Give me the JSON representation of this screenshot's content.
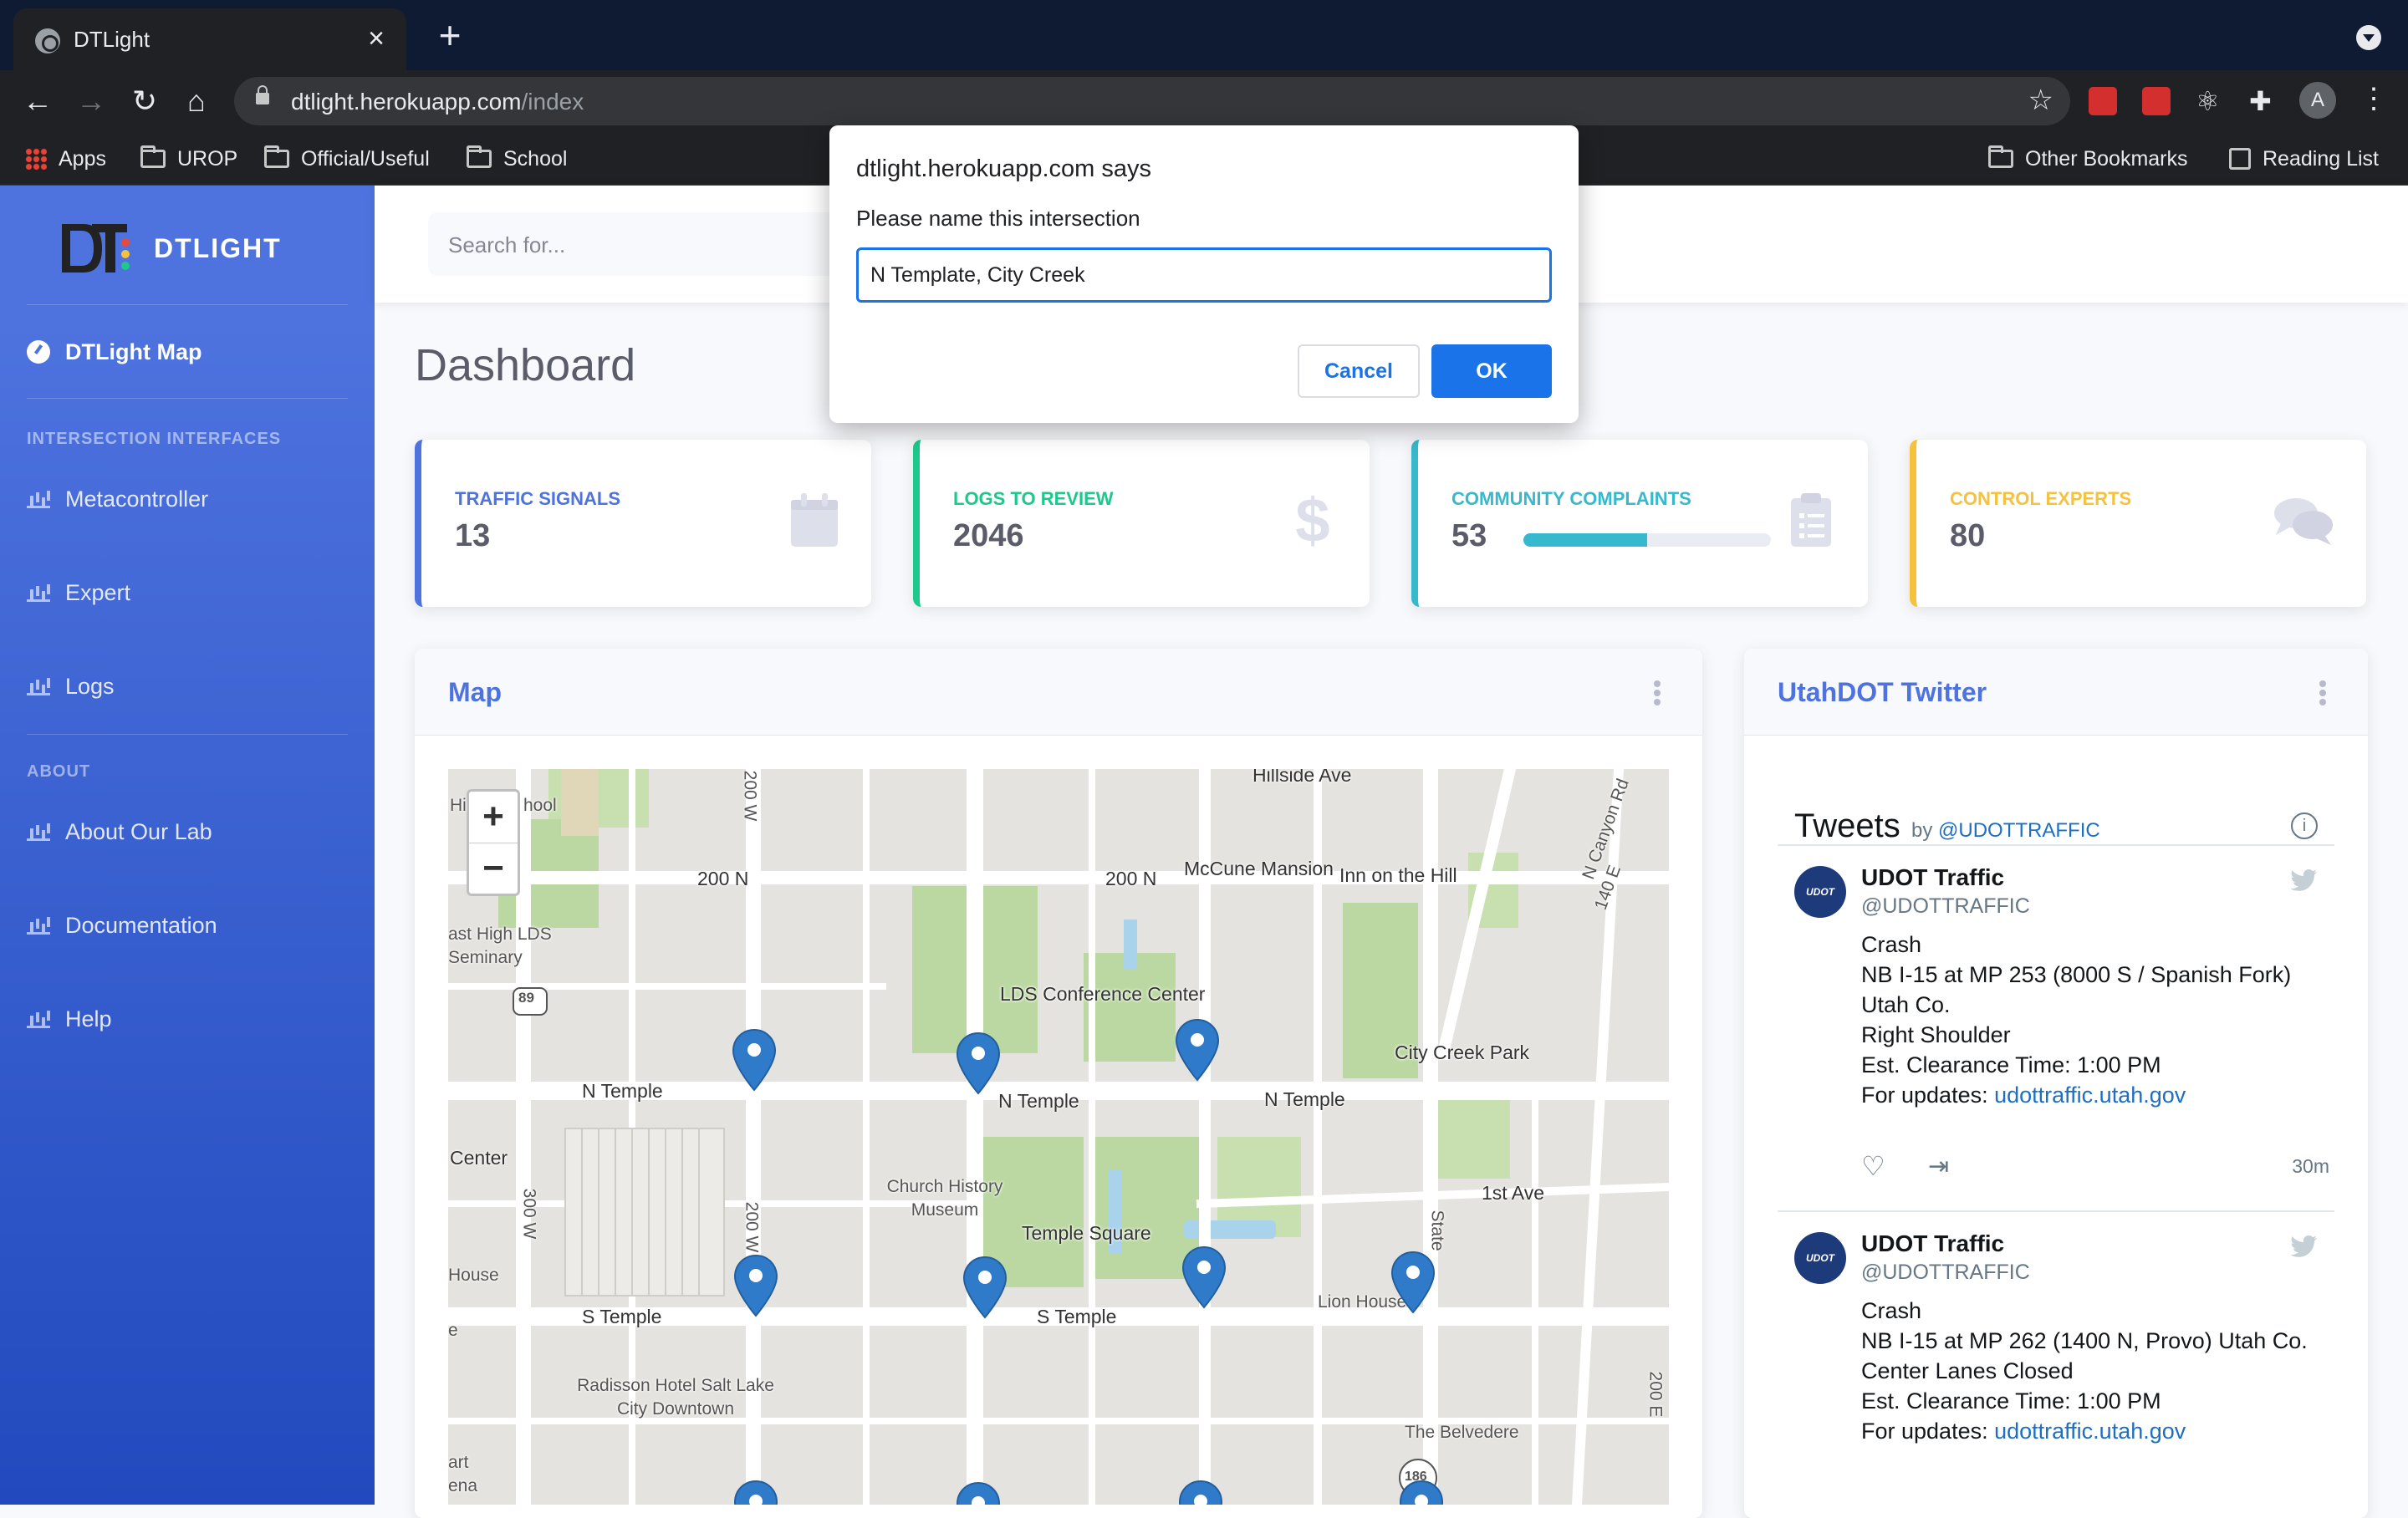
{
  "browser": {
    "tab_title": "DTLight",
    "url_host": "dtlight.herokuapp.com",
    "url_path": "/index",
    "bookmarks": [
      "Apps",
      "UROP",
      "Official/Useful",
      "School"
    ],
    "bookmarks_right": [
      "Other Bookmarks",
      "Reading List"
    ],
    "avatar_letter": "A"
  },
  "sidebar": {
    "brand": "DTLIGHT",
    "map_item": "DTLight Map",
    "heading_interfaces": "INTERSECTION INTERFACES",
    "interface_items": [
      "Metacontroller",
      "Expert",
      "Logs"
    ],
    "heading_about": "ABOUT",
    "about_items": [
      "About Our Lab",
      "Documentation",
      "Help"
    ]
  },
  "topbar": {
    "search_placeholder": "Search for..."
  },
  "page": {
    "title": "Dashboard"
  },
  "cards": [
    {
      "label": "TRAFFIC SIGNALS",
      "value": "13",
      "color": "#4e73df",
      "icon": "calendar-icon"
    },
    {
      "label": "LOGS TO REVIEW",
      "value": "2046",
      "color": "#1cc88a",
      "icon": "dollar-icon"
    },
    {
      "label": "COMMUNITY COMPLAINTS",
      "value": "53",
      "color": "#36b9cc",
      "icon": "clipboard-icon",
      "progress": 0.5
    },
    {
      "label": "CONTROL EXPERTS",
      "value": "80",
      "color": "#f6c23e",
      "icon": "comments-icon"
    }
  ],
  "map_panel": {
    "title": "Map",
    "labels": [
      "Hillside Ave",
      "200 N",
      "200 N",
      "McCune Mansion",
      "Inn on the Hill",
      "N Canyon Rd",
      "140 E",
      "200 W",
      "LDS Conference Center",
      "City Creek Park",
      "N Temple",
      "N Temple",
      "N Temple",
      "Center",
      "Church History Museum",
      "Temple Square",
      "1st Ave",
      "300 W",
      "200 W",
      "State",
      "House",
      "S Temple",
      "S Temple",
      "Lion House",
      "Radisson Hotel Salt Lake City Downtown",
      "The Belvedere",
      "200 E",
      "ast High LDS Seminary",
      "Hi",
      "hool",
      "89",
      "186",
      "art",
      "ena",
      "e"
    ]
  },
  "twitter_panel": {
    "title": "UtahDOT Twitter",
    "tweets_heading": "Tweets",
    "by": "by",
    "by_handle": "@UDOTTRAFFIC",
    "tweets": [
      {
        "name": "UDOT Traffic",
        "handle": "@UDOTTRAFFIC",
        "lines": [
          "Crash",
          "NB I-15 at MP 253 (8000 S / Spanish Fork) Utah Co.",
          "Right Shoulder",
          "Est. Clearance Time: 1:00 PM"
        ],
        "updates_prefix": "For updates:",
        "link": "udottraffic.utah.gov",
        "time": "30m"
      },
      {
        "name": "UDOT Traffic",
        "handle": "@UDOTTRAFFIC",
        "lines": [
          "Crash",
          "NB I-15 at MP 262 (1400 N, Provo) Utah Co.",
          "Center Lanes Closed",
          "Est. Clearance Time: 1:00 PM"
        ],
        "updates_prefix": "For updates:",
        "link": "udottraffic.utah.gov"
      }
    ]
  },
  "dialog": {
    "title": "dtlight.herokuapp.com says",
    "message": "Please name this intersection",
    "input_value": "N Template, City Creek",
    "cancel": "Cancel",
    "ok": "OK"
  }
}
